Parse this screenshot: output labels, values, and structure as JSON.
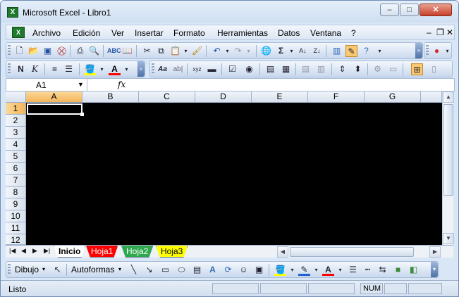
{
  "window": {
    "title": "Microsoft Excel - Libro1",
    "app_icon": "excel-icon",
    "controls": {
      "minimize": "–",
      "maximize": "□",
      "close": "✕"
    }
  },
  "menubar": {
    "items": [
      "Archivo",
      "Edición",
      "Ver",
      "Insertar",
      "Formato",
      "Herramientas",
      "Datos",
      "Ventana",
      "?"
    ],
    "doc_controls": {
      "minimize": "–",
      "restore": "❐",
      "close": "✕"
    }
  },
  "toolbar_standard": {
    "icons": [
      "new-icon",
      "open-icon",
      "save-icon",
      "permission-icon",
      "print-icon",
      "print-preview-icon",
      "spelling-icon",
      "research-icon",
      "cut-icon",
      "copy-icon",
      "paste-icon",
      "format-painter-icon",
      "undo-icon",
      "redo-icon",
      "hyperlink-icon",
      "autosum-icon",
      "sort-ascending-icon",
      "sort-descending-icon",
      "chart-wizard-icon",
      "drawing-icon",
      "help-icon"
    ],
    "autosum_glyph": "Σ"
  },
  "toolbar_formatting": {
    "bold_label": "N",
    "italic_label": "K",
    "font_color_label": "A"
  },
  "formula_bar": {
    "name_box": "A1",
    "fx_label": "fx",
    "value": ""
  },
  "grid": {
    "columns": [
      "A",
      "B",
      "C",
      "D",
      "E",
      "F",
      "G"
    ],
    "rows": [
      "1",
      "2",
      "3",
      "4",
      "5",
      "6",
      "7",
      "8",
      "9",
      "10",
      "11",
      "12"
    ],
    "active_cell": "A1",
    "cell_background": "#000000"
  },
  "sheets": {
    "tabs": [
      {
        "label": "Inicio",
        "color": "#ffffff",
        "text_color": "#000000",
        "active": true
      },
      {
        "label": "Hoja1",
        "color": "#ff0000",
        "text_color": "#ffffff",
        "active": false
      },
      {
        "label": "Hoja2",
        "color": "#2fa84f",
        "text_color": "#ffffff",
        "active": false
      },
      {
        "label": "Hoja3",
        "color": "#ffff00",
        "text_color": "#000000",
        "active": false
      }
    ]
  },
  "drawing_toolbar": {
    "draw_label": "Dibujo",
    "autoshapes_label": "Autoformas"
  },
  "status": {
    "text": "Listo",
    "num_indicator": "NUM"
  },
  "colors": {
    "fill_color": "#ffff00",
    "font_color": "#ff0000",
    "line_color": "#2060d0"
  }
}
